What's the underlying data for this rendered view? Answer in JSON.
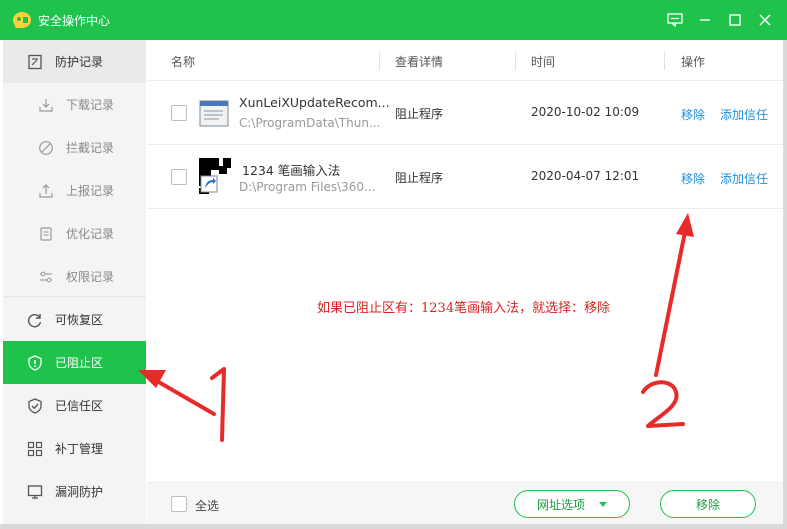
{
  "window": {
    "title": "安全操作中心",
    "controls": [
      "feedback-icon",
      "minimize-icon",
      "maximize-icon",
      "close-icon"
    ]
  },
  "sidebar": {
    "items": [
      {
        "label": "防护记录",
        "icon": "notes-icon",
        "level": "top"
      },
      {
        "label": "下载记录",
        "icon": "download-icon",
        "level": "sub"
      },
      {
        "label": "拦截记录",
        "icon": "block-icon",
        "level": "sub"
      },
      {
        "label": "上报记录",
        "icon": "upload-icon",
        "level": "sub"
      },
      {
        "label": "优化记录",
        "icon": "clipboard-icon",
        "level": "sub"
      },
      {
        "label": "权限记录",
        "icon": "sliders-icon",
        "level": "sub"
      },
      {
        "label": "可恢复区",
        "icon": "restore-icon",
        "level": "top"
      },
      {
        "label": "已阻止区",
        "icon": "shield-alert-icon",
        "level": "top",
        "active": true
      },
      {
        "label": "已信任区",
        "icon": "shield-check-icon",
        "level": "top"
      },
      {
        "label": "补丁管理",
        "icon": "grid-icon",
        "level": "top"
      },
      {
        "label": "漏洞防护",
        "icon": "monitor-icon",
        "level": "top"
      }
    ]
  },
  "table": {
    "headers": {
      "name": "名称",
      "details": "查看详情",
      "time": "时间",
      "action": "操作"
    },
    "rows": [
      {
        "name": "XunLeiXUpdateRecom...",
        "path": "C:\\ProgramData\\Thun...",
        "detail": "阻止程序",
        "time": "2020-10-02 10:09",
        "remove": "移除",
        "trust": "添加信任",
        "icon": "window-app-icon"
      },
      {
        "name": "1234 笔画输入法",
        "path": "D:\\Program Files\\360...",
        "detail": "阻止程序",
        "time": "2020-04-07 12:01",
        "remove": "移除",
        "trust": "添加信任",
        "icon": "shortcut-app-icon"
      }
    ]
  },
  "annotation": {
    "text": "如果已阻止区有：1234笔画输入法，就选择：移除",
    "color": "#e02020"
  },
  "footer": {
    "select_all": "全选",
    "url_options": "网址选项",
    "remove": "移除"
  },
  "colors": {
    "accent": "#1fc34b",
    "link": "#1e8fe0",
    "annotation": "#e02020"
  }
}
